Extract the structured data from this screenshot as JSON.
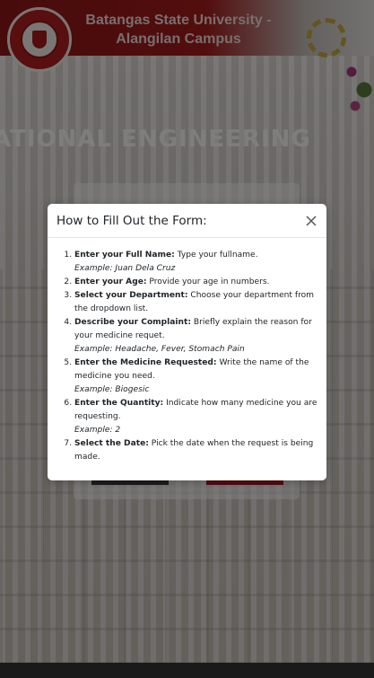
{
  "header": {
    "title": "Batangas State University - Alangilan Campus"
  },
  "background": {
    "banner_text": "ATIONAL ENGINEERING"
  },
  "modal": {
    "title": "How to Fill Out the Form:",
    "close_label": "×",
    "steps": [
      {
        "bold": "Enter your Full Name:",
        "text": " Type your fullname.",
        "example": "Example: Juan Dela Cruz"
      },
      {
        "bold": "Enter your Age:",
        "text": " Provide your age in numbers.",
        "example": ""
      },
      {
        "bold": "Select your Department:",
        "text": " Choose your department from the dropdown list.",
        "example": ""
      },
      {
        "bold": "Describe your Complaint:",
        "text": " Briefly explain the reason for your medicine requet.",
        "example": "Example: Headache, Fever, Stomach Pain"
      },
      {
        "bold": "Enter the Medicine Requested:",
        "text": " Write the name of the medicine you need.",
        "example": "Example: Biogesic"
      },
      {
        "bold": "Enter the Quantity:",
        "text": " Indicate how many medicine you are requesting.",
        "example": "Example: 2"
      },
      {
        "bold": "Select the Date:",
        "text": " Pick the date when the request is being made.",
        "example": ""
      }
    ]
  },
  "colors": {
    "brand_red": "#a61b1b",
    "overlay": "rgba(0,0,0,0.5)"
  }
}
